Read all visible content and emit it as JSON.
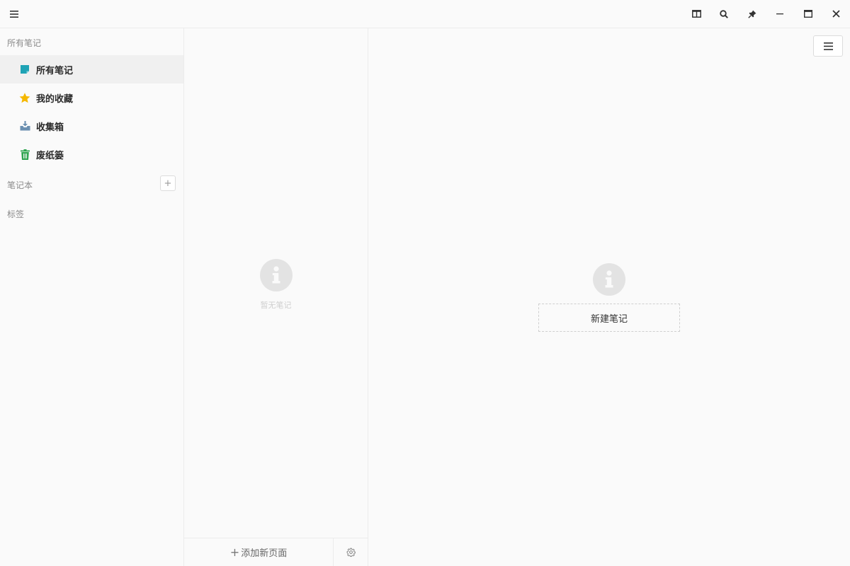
{
  "titlebar": {
    "icons": [
      "menu-icon",
      "split-view-icon",
      "search-icon",
      "pin-icon",
      "minimize-icon",
      "maximize-icon",
      "close-icon"
    ]
  },
  "sidebar": {
    "all_notes_header": "所有笔记",
    "items": [
      {
        "label": "所有笔记",
        "icon": "note-icon",
        "color": "#1fa3b5",
        "active": true
      },
      {
        "label": "我的收藏",
        "icon": "star-icon",
        "color": "#f5b800",
        "active": false
      },
      {
        "label": "收集箱",
        "icon": "inbox-icon",
        "color": "#6a8fb0",
        "active": false
      },
      {
        "label": "废纸篓",
        "icon": "trash-icon",
        "color": "#2ea44f",
        "active": false
      }
    ],
    "notebooks_header": "笔记本",
    "add_notebook_label": "+",
    "tags_header": "标签"
  },
  "note_list": {
    "empty_text": "暂无笔记",
    "add_page_plus": "+",
    "add_page_label": "添加新页面"
  },
  "editor": {
    "new_note_label": "新建笔记"
  }
}
